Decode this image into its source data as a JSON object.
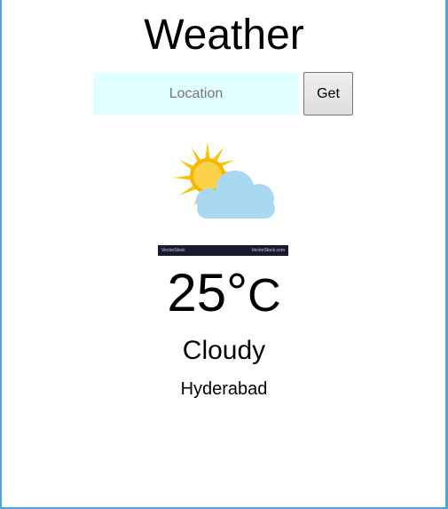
{
  "app": {
    "title": "Weather"
  },
  "search": {
    "placeholder": "Location",
    "value": "",
    "button_label": "Get"
  },
  "weather": {
    "icon": "partly-cloudy-icon",
    "temperature": "25°",
    "unit": "C",
    "condition": "Cloudy",
    "city": "Hyderabad"
  },
  "colors": {
    "input_background": "#e0ffff",
    "sun": "#f9c513",
    "cloud": "#a9d8f2",
    "frame_border": "#4aa3df"
  }
}
